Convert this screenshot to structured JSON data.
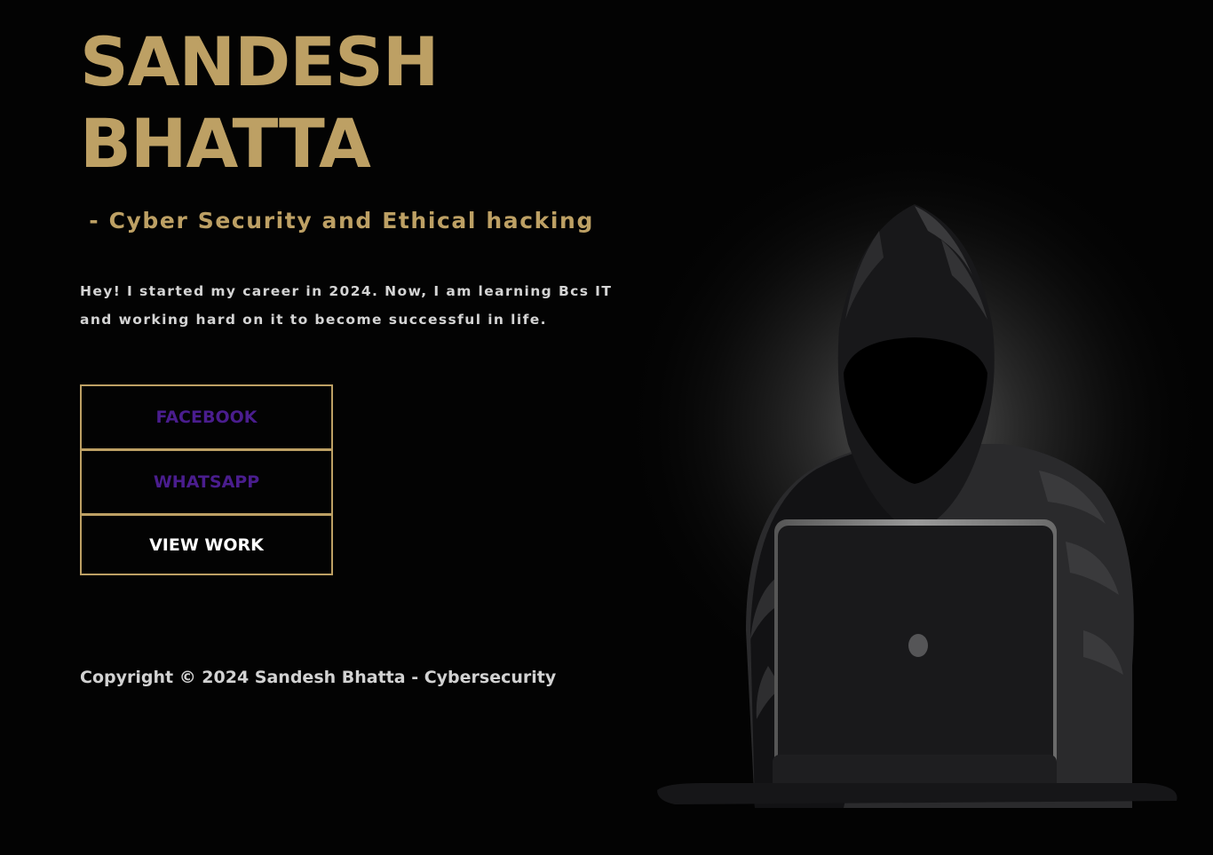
{
  "header": {
    "name_line1": "SANDESH",
    "name_line2": "BHATTA",
    "tagline": " - Cyber Security and Ethical hacking"
  },
  "intro": {
    "text": "Hey! I started my career in 2024. Now, I am learning Bcs IT and working hard on it to become successful in life."
  },
  "buttons": {
    "facebook": "FACEBOOK",
    "whatsapp": "WHATSAPP",
    "view_work": "VIEW WORK"
  },
  "footer": {
    "copyright": "Copyright © 2024 Sandesh Bhatta - Cybersecurity"
  },
  "hero_image": {
    "icon": "hooded-hacker-with-laptop"
  },
  "colors": {
    "background": "#030303",
    "accent_gold": "#bda064",
    "link_purple": "#4a1d8e",
    "text_light": "#d4d4d4"
  }
}
